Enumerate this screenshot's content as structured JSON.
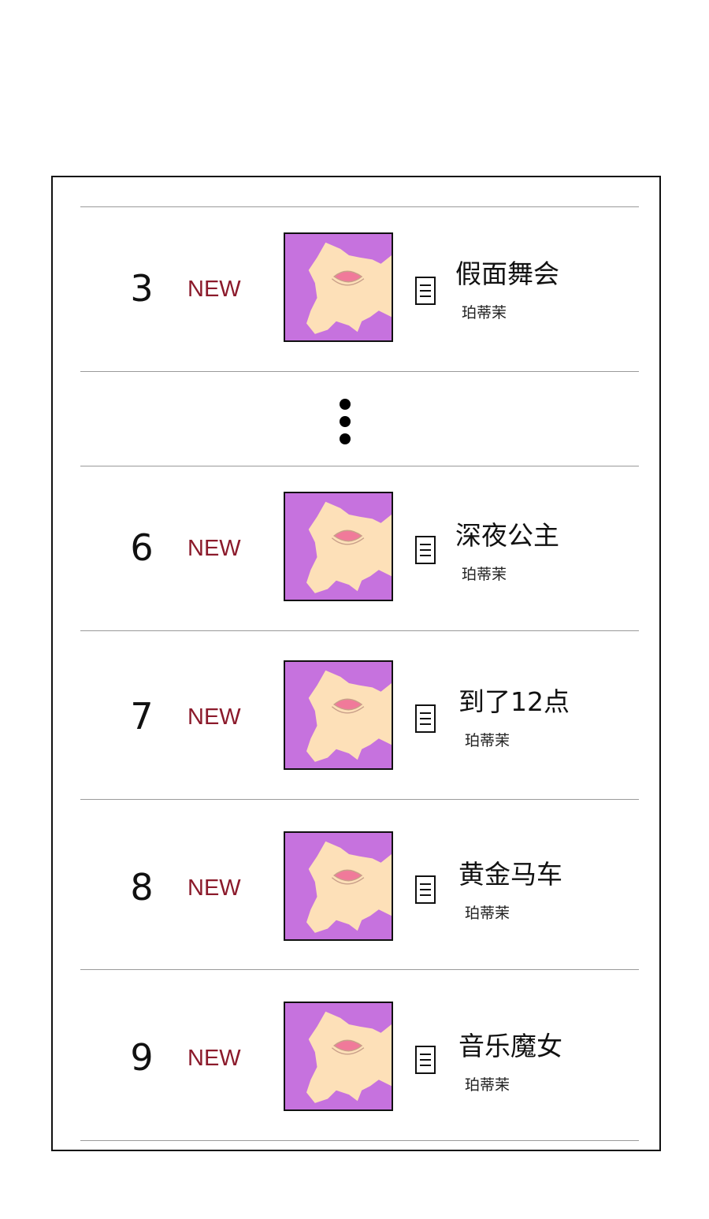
{
  "chapters": [
    {
      "rank": "3",
      "badge": "NEW",
      "title": "假面舞会",
      "author": "珀蒂茉"
    },
    {
      "rank": "6",
      "badge": "NEW",
      "title": "深夜公主",
      "author": "珀蒂茉"
    },
    {
      "rank": "7",
      "badge": "NEW",
      "title": "到了12点",
      "author": "珀蒂茉"
    },
    {
      "rank": "8",
      "badge": "NEW",
      "title": "黄金马车",
      "author": "珀蒂茉"
    },
    {
      "rank": "9",
      "badge": "NEW",
      "title": "音乐魔女",
      "author": "珀蒂茉"
    }
  ],
  "icons": {
    "document": "document-icon",
    "more": "vertical-ellipsis-icon"
  },
  "colors": {
    "badge": "#8b1a2b",
    "thumbnail_bg": "#c672de",
    "thumbnail_shape": "#fde0b8",
    "thumbnail_lips": "#f07a9a"
  }
}
